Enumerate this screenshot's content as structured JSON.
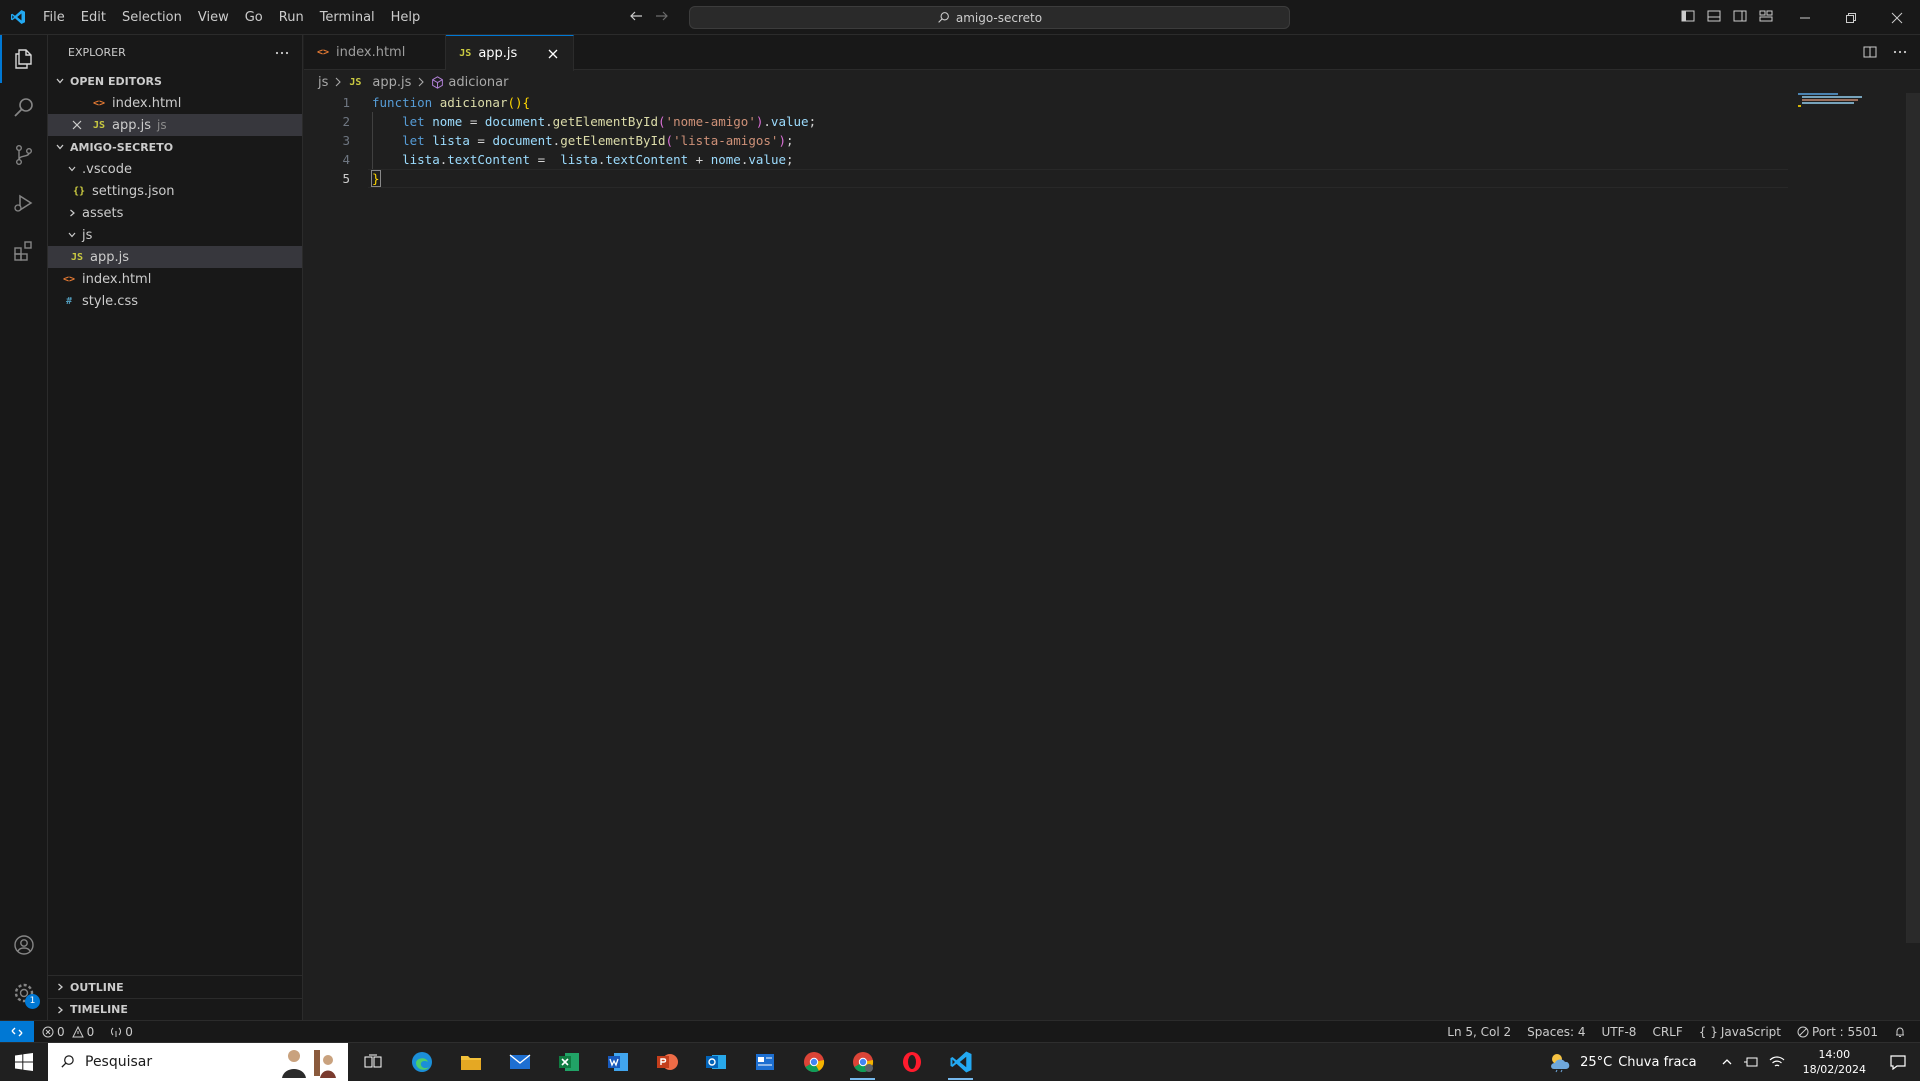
{
  "titlebar": {
    "menu": [
      "File",
      "Edit",
      "Selection",
      "View",
      "Go",
      "Run",
      "Terminal",
      "Help"
    ],
    "command_center": "amigo-secreto"
  },
  "activity_badge": "1",
  "explorer": {
    "title": "EXPLORER",
    "open_editors_title": "OPEN EDITORS",
    "open_editors": [
      {
        "name": "index.html",
        "desc": ""
      },
      {
        "name": "app.js",
        "desc": "js"
      }
    ],
    "project_title": "AMIGO-SECRETO",
    "tree": {
      "vscode_folder": ".vscode",
      "settings_file": "settings.json",
      "assets_folder": "assets",
      "js_folder": "js",
      "app_file": "app.js",
      "index_file": "index.html",
      "style_file": "style.css"
    },
    "outline_title": "OUTLINE",
    "timeline_title": "TIMELINE"
  },
  "tabs": [
    {
      "label": "index.html"
    },
    {
      "label": "app.js"
    }
  ],
  "breadcrumb": {
    "folder": "js",
    "file": "app.js",
    "symbol": "adicionar"
  },
  "editor": {
    "line_numbers": [
      "1",
      "2",
      "3",
      "4",
      "5"
    ],
    "code": {
      "l1_kw": "function",
      "l1_fn": "adicionar",
      "l2_kw": "let",
      "l2_var": "nome",
      "l2_obj": "document",
      "l2_fn": "getElementById",
      "l2_str": "'nome-amigo'",
      "l2_prop": "value",
      "l3_kw": "let",
      "l3_var": "lista",
      "l3_obj": "document",
      "l3_fn": "getElementById",
      "l3_str": "'lista-amigos'",
      "l4_var": "lista",
      "l4_prop": "textContent",
      "l4_var2": "lista",
      "l4_prop2": "textContent",
      "l4_var3": "nome",
      "l4_prop3": "value"
    }
  },
  "statusbar": {
    "errors": "0",
    "warnings": "0",
    "ports": "0",
    "position": "Ln 5, Col 2",
    "spaces": "Spaces: 4",
    "encoding": "UTF-8",
    "eol": "CRLF",
    "language": "JavaScript",
    "port": "Port : 5501"
  },
  "taskbar": {
    "search_placeholder": "Pesquisar",
    "weather_temp": "25°C",
    "weather_desc": "Chuva fraca",
    "time": "14:00",
    "date": "18/02/2024"
  },
  "colors": {
    "accent": "#0078d4",
    "background": "#1f1f1f",
    "sidebar": "#181818"
  }
}
